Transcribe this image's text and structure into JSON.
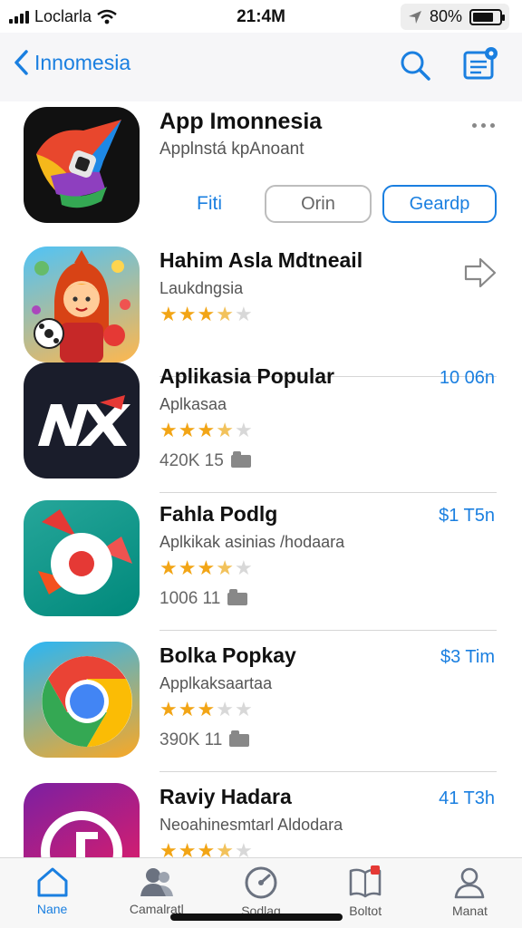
{
  "status_bar": {
    "carrier": "Loclarla",
    "time": "21:4M",
    "battery": "80%",
    "battery_level": 0.8
  },
  "nav": {
    "back_label": "Innomesia",
    "search_icon": "search-icon",
    "updates_icon": "updates-icon"
  },
  "header_app": {
    "title": "App Imonnesia",
    "subtitle": "Applnstá kpAnoant",
    "btn_plain": "Fiti",
    "btn_gray": "Orin",
    "btn_blue": "Geardp"
  },
  "apps": [
    {
      "title": "Hahim Asla Mdtneail",
      "subtitle": "Laukdngsia",
      "rating": 3.5,
      "meta": "",
      "price": ""
    },
    {
      "title": "Aplikasia Popular",
      "subtitle": "Aplkasaa",
      "rating": 3.5,
      "meta": "420K 15",
      "price": "10 06n"
    },
    {
      "title": "Fahla Podlg",
      "subtitle": "Aplkikak asinias /hodaara",
      "rating": 3.5,
      "meta": "1006 11",
      "price": "$1 T5n"
    },
    {
      "title": "Bolka Popkay",
      "subtitle": "Applkaksaartaa",
      "rating": 3,
      "meta": "390K 11",
      "price": "$3 Tim"
    },
    {
      "title": "Raviy Hadara",
      "subtitle": "Neoahinesmtarl Aldodara",
      "rating": 3.5,
      "meta": "",
      "price": "41 T3h"
    }
  ],
  "tabs": [
    {
      "label": "Nane",
      "icon": "home-icon",
      "active": true
    },
    {
      "label": "Camalratl",
      "icon": "people-icon",
      "active": false
    },
    {
      "label": "Sodlag",
      "icon": "gauge-icon",
      "active": false
    },
    {
      "label": "Boltot",
      "icon": "book-icon",
      "active": false
    },
    {
      "label": "Manat",
      "icon": "person-icon",
      "active": false
    }
  ],
  "colors": {
    "accent": "#1a7fe0",
    "star": "#f2a516"
  }
}
